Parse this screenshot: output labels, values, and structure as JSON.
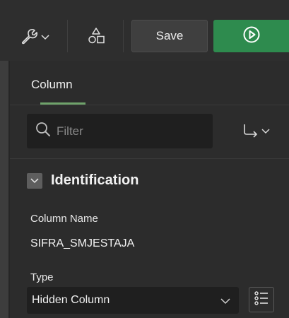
{
  "toolbar": {
    "wrench_icon": "wrench-icon",
    "shared_components_icon": "shapes-icon",
    "save_label": "Save",
    "run_icon": "play-circle-icon",
    "run_color": "#2e8b4e"
  },
  "tabs": [
    {
      "label": "Column",
      "active": true
    }
  ],
  "filter": {
    "placeholder": "Filter"
  },
  "section": {
    "title": "Identification",
    "collapsed_icon": "chevron-down-icon"
  },
  "fields": {
    "column_name": {
      "label": "Column Name",
      "value": "SIFRA_SMJESTAJA"
    },
    "type": {
      "label": "Type",
      "value": "Hidden Column"
    }
  },
  "colors": {
    "accent": "#6fa36b",
    "background": "#2c2c2c"
  }
}
